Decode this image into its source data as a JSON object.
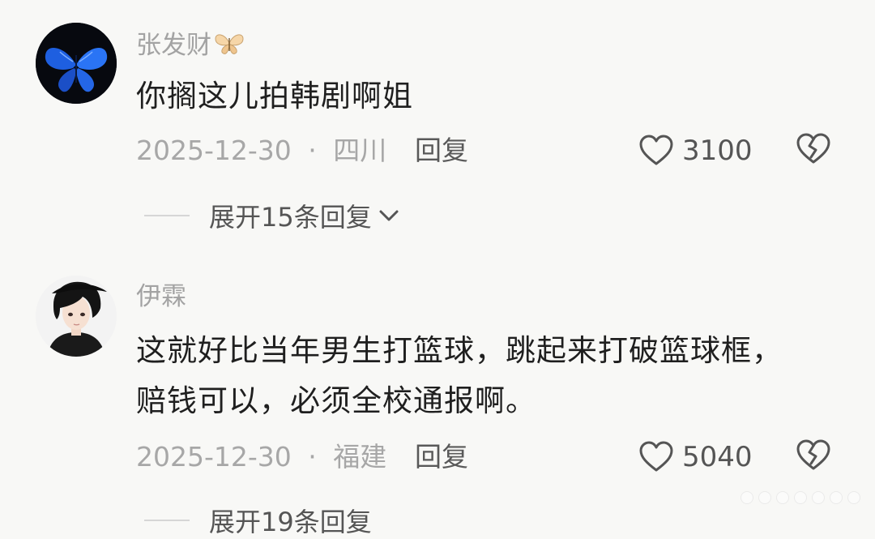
{
  "comments": [
    {
      "username": "张发财",
      "flag_icon": "butterfly-icon",
      "lines": [
        "你搁这儿拍韩剧啊姐"
      ],
      "date": "2025-12-30",
      "separator": "·",
      "location": "四川",
      "reply_label": "回复",
      "likes": "3100",
      "expand_label": "展开15条回复",
      "avatar": "blue-butterfly"
    },
    {
      "username": "伊霖",
      "lines": [
        "这就好比当年男生打篮球，跳起来打破篮球框，",
        "赔钱可以，必须全校通报啊。"
      ],
      "date": "2025-12-30",
      "separator": "·",
      "location": "福建",
      "reply_label": "回复",
      "likes": "5040",
      "expand_label": "展开19条回复",
      "avatar": "anime-boy"
    }
  ],
  "colors": {
    "background": "#f8f8f6",
    "username": "#a3a3a3",
    "content": "#1f1f1f",
    "meta": "#a7a7a7",
    "action": "#555555"
  }
}
